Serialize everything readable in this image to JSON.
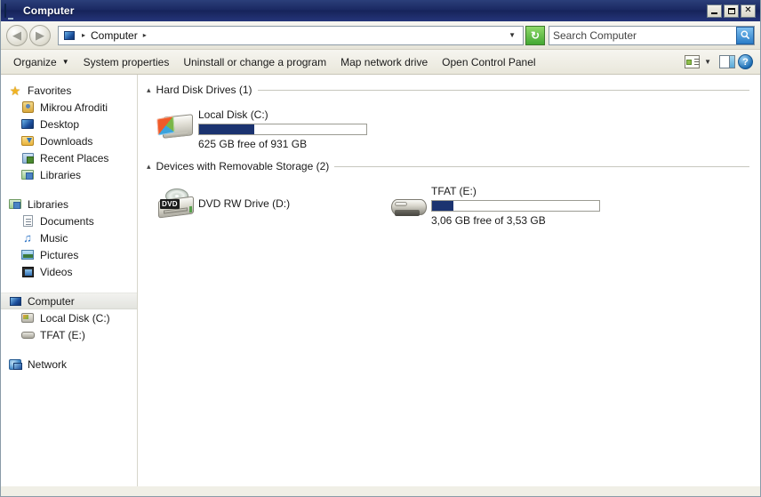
{
  "window": {
    "title": "Computer",
    "title_icon": "computer-monitor-icon",
    "controls": {
      "minimize": "minimize-icon",
      "maximize": "maximize-icon",
      "close": "✕"
    }
  },
  "address_bar": {
    "back_icon": "◀",
    "forward_icon": "▶",
    "location_icon": "computer-monitor-icon",
    "crumbs": [
      "Computer"
    ],
    "separator": "▸",
    "dropdown_icon": "▼",
    "refresh_icon": "↻",
    "search": {
      "placeholder": "Search Computer",
      "value": "",
      "button_icon": "🔍"
    }
  },
  "toolbar": {
    "items": [
      {
        "label": "Organize",
        "has_caret": true,
        "caret": "▼"
      },
      {
        "label": "System properties",
        "has_caret": false,
        "caret": ""
      },
      {
        "label": "Uninstall or change a program",
        "has_caret": false,
        "caret": ""
      },
      {
        "label": "Map network drive",
        "has_caret": false,
        "caret": ""
      },
      {
        "label": "Open Control Panel",
        "has_caret": false,
        "caret": ""
      }
    ],
    "right": {
      "views_icon": "view-options-icon",
      "views_caret": "▼",
      "preview_pane_icon": "preview-pane-icon",
      "help_icon": "?"
    }
  },
  "sidebar": {
    "sections": [
      {
        "name": "favorites",
        "header": {
          "label": "Favorites",
          "icon": "star-icon"
        },
        "items": [
          {
            "label": "Mikrou Afroditi",
            "icon": "user-icon"
          },
          {
            "label": "Desktop",
            "icon": "desktop-icon"
          },
          {
            "label": "Downloads",
            "icon": "downloads-folder-icon"
          },
          {
            "label": "Recent Places",
            "icon": "recent-places-icon"
          },
          {
            "label": "Libraries",
            "icon": "libraries-icon"
          }
        ]
      },
      {
        "name": "libraries",
        "header": {
          "label": "Libraries",
          "icon": "libraries-icon"
        },
        "items": [
          {
            "label": "Documents",
            "icon": "documents-icon"
          },
          {
            "label": "Music",
            "icon": "music-icon"
          },
          {
            "label": "Pictures",
            "icon": "pictures-icon"
          },
          {
            "label": "Videos",
            "icon": "videos-icon"
          }
        ]
      },
      {
        "name": "computer",
        "header": {
          "label": "Computer",
          "icon": "computer-icon",
          "selected": true
        },
        "items": [
          {
            "label": "Local Disk (C:)",
            "icon": "hard-disk-icon"
          },
          {
            "label": "TFAT (E:)",
            "icon": "usb-drive-icon"
          }
        ]
      },
      {
        "name": "network",
        "header": {
          "label": "Network",
          "icon": "network-icon"
        },
        "items": []
      }
    ]
  },
  "content": {
    "groups": [
      {
        "id": "hard-disk-drives",
        "collapse_icon": "▴",
        "title": "Hard Disk Drives (1)",
        "drives": [
          {
            "name": "Local Disk (C:)",
            "icon": "hard-disk-icon",
            "capacity_text": "625 GB free of 931 GB",
            "free": "625 GB",
            "total": "931 GB",
            "used_percent": 33,
            "bar_color": "#1b3370",
            "has_bar": true
          }
        ]
      },
      {
        "id": "removable-storage",
        "collapse_icon": "▴",
        "title": "Devices with Removable Storage (2)",
        "drives": [
          {
            "name": "DVD RW Drive (D:)",
            "icon": "dvd-drive-icon",
            "badge": "DVD",
            "capacity_text": "",
            "free": "",
            "total": "",
            "used_percent": 0,
            "bar_color": "#1b3370",
            "has_bar": false
          },
          {
            "name": "TFAT (E:)",
            "icon": "usb-drive-icon",
            "capacity_text": "3,06 GB free of 3,53 GB",
            "free": "3,06 GB",
            "total": "3,53 GB",
            "used_percent": 13,
            "bar_color": "#1b3370",
            "has_bar": true
          }
        ]
      }
    ]
  },
  "colors": {
    "titlebar": "#16235a",
    "chrome": "#ebe9de",
    "selection": "#e6e7e2",
    "bar_fill": "#1b3370",
    "accent_green": "#43a832"
  }
}
